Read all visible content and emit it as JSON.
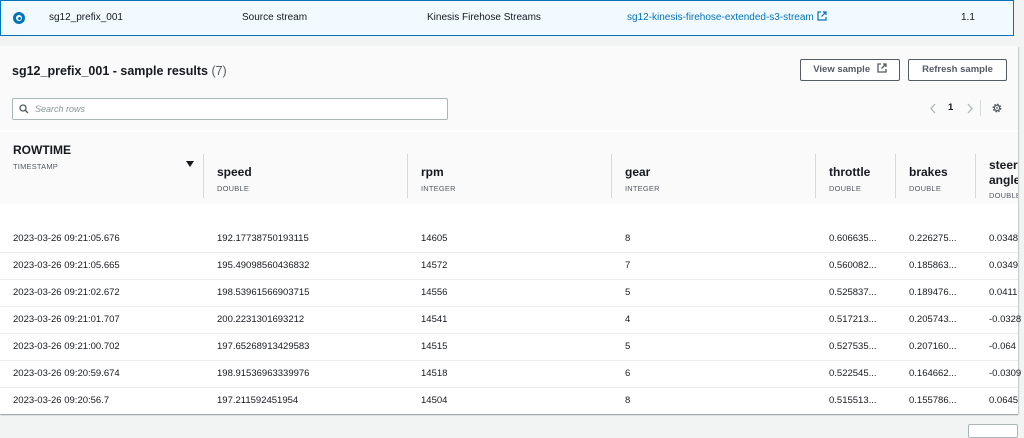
{
  "source_row": {
    "name": "sg12_prefix_001",
    "role": "Source stream",
    "type": "Kinesis Firehose Streams",
    "link": "sg12-kinesis-firehose-extended-s3-stream",
    "version": "1.1"
  },
  "panel": {
    "title": "sg12_prefix_001 - sample results",
    "count": "(7)",
    "view_sample_label": "View sample",
    "refresh_sample_label": "Refresh sample",
    "search_placeholder": "Search rows",
    "current_page": "1"
  },
  "columns": [
    {
      "name": "ROWTIME",
      "type": "TIMESTAMP"
    },
    {
      "name": "speed",
      "type": "DOUBLE"
    },
    {
      "name": "rpm",
      "type": "INTEGER"
    },
    {
      "name": "gear",
      "type": "INTEGER"
    },
    {
      "name": "throttle",
      "type": "DOUBLE"
    },
    {
      "name": "brakes",
      "type": "DOUBLE"
    },
    {
      "name": "steering angle",
      "name_line1": "steeri",
      "name_line2": "angle",
      "type": "DOUBLE"
    }
  ],
  "rows": [
    [
      "2023-03-26 09:21:05.676",
      "192.17738750193115",
      "14605",
      "8",
      "0.606635...",
      "0.226275...",
      "0.0348"
    ],
    [
      "2023-03-26 09:21:05.665",
      "195.49098560436832",
      "14572",
      "7",
      "0.560082...",
      "0.185863...",
      "0.0349"
    ],
    [
      "2023-03-26 09:21:02.672",
      "198.53961566903715",
      "14556",
      "5",
      "0.525837...",
      "0.189476...",
      "0.0411"
    ],
    [
      "2023-03-26 09:21:01.707",
      "200.2231301693212",
      "14541",
      "4",
      "0.517213...",
      "0.205743...",
      "-0.0328"
    ],
    [
      "2023-03-26 09:21:00.702",
      "197.65268913429583",
      "14515",
      "5",
      "0.527535...",
      "0.207160...",
      "-0.064"
    ],
    [
      "2023-03-26 09:20:59.674",
      "198.91536963339976",
      "14518",
      "6",
      "0.522545...",
      "0.164662...",
      "-0.0309"
    ],
    [
      "2023-03-26 09:20:56.7",
      "197.211592451954",
      "14504",
      "8",
      "0.515513...",
      "0.155786...",
      "0.0645"
    ]
  ],
  "icons": {
    "external": "external-link-icon",
    "search": "search-icon",
    "settings": "gear-icon",
    "sort": "sort-down-icon"
  },
  "colors": {
    "accent": "#0073bb",
    "text": "#16191f",
    "muted": "#545b64"
  }
}
